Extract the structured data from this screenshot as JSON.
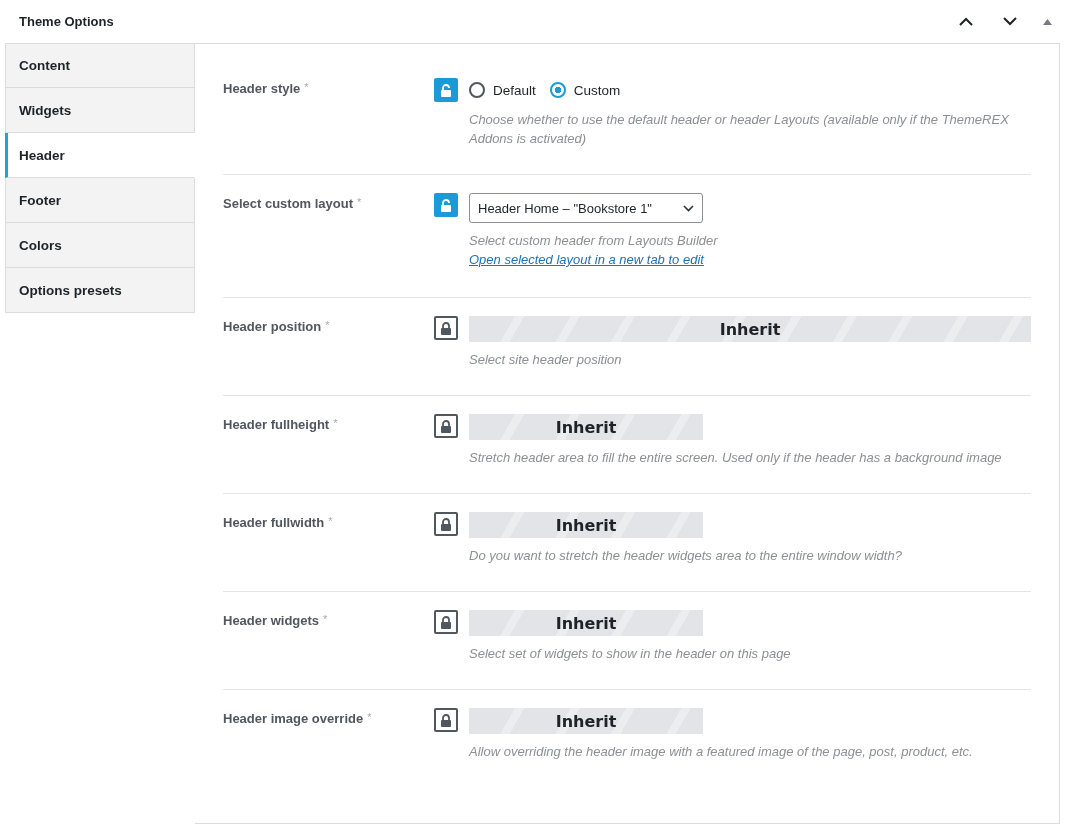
{
  "panel": {
    "title": "Theme Options"
  },
  "tabs": [
    {
      "label": "Content",
      "selected": false
    },
    {
      "label": "Widgets",
      "selected": false
    },
    {
      "label": "Header",
      "selected": true
    },
    {
      "label": "Footer",
      "selected": false
    },
    {
      "label": "Colors",
      "selected": false
    },
    {
      "label": "Options presets",
      "selected": false
    }
  ],
  "options": [
    {
      "label": "Header style",
      "mark": "*",
      "locked": false,
      "kind": "radio",
      "choices": [
        {
          "label": "Default",
          "selected": false
        },
        {
          "label": "Custom",
          "selected": true
        }
      ],
      "description": "Choose whether to use the default header or header Layouts (available only if the ThemeREX Addons is activated)"
    },
    {
      "label": "Select custom layout",
      "mark": "*",
      "locked": false,
      "kind": "select",
      "value": "Header Home – \"Bookstore 1\"",
      "description": "Select custom header from Layouts Builder",
      "link": "Open selected layout in a new tab to edit"
    },
    {
      "label": "Header position",
      "mark": "*",
      "locked": true,
      "kind": "inherit-full",
      "value": "Inherit",
      "description": "Select site header position"
    },
    {
      "label": "Header fullheight",
      "mark": "*",
      "locked": true,
      "kind": "inherit",
      "value": "Inherit",
      "description": "Stretch header area to fill the entire screen. Used only if the header has a background image"
    },
    {
      "label": "Header fullwidth",
      "mark": "*",
      "locked": true,
      "kind": "inherit",
      "value": "Inherit",
      "description": "Do you want to stretch the header widgets area to the entire window width?"
    },
    {
      "label": "Header widgets",
      "mark": "*",
      "locked": true,
      "kind": "inherit",
      "value": "Inherit",
      "description": "Select set of widgets to show in the header on this page"
    },
    {
      "label": "Header image override",
      "mark": "*",
      "locked": true,
      "kind": "inherit",
      "value": "Inherit",
      "description": "Allow overriding the header image with a featured image of the page, post, product, etc."
    }
  ]
}
